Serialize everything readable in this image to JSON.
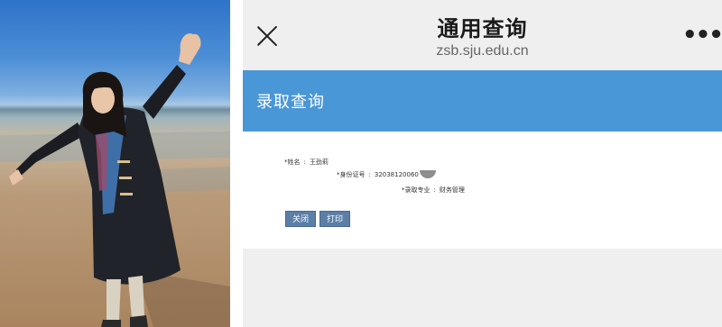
{
  "browser": {
    "title": "通用查询",
    "url": "zsb.sju.edu.cn",
    "close_icon": "close-icon",
    "more_icon": "more-icon",
    "more_glyph": "•••"
  },
  "page": {
    "header": "录取查询",
    "accent_color": "#4a97d7"
  },
  "result": {
    "name_label": "*姓名",
    "name_value": "王劲莉",
    "id_label": "*身份证号",
    "id_value": "32038120060",
    "major_label": "*录取专业",
    "major_value": "财务管理",
    "separator": ":"
  },
  "actions": {
    "close_label": "关闭",
    "print_label": "打印"
  }
}
